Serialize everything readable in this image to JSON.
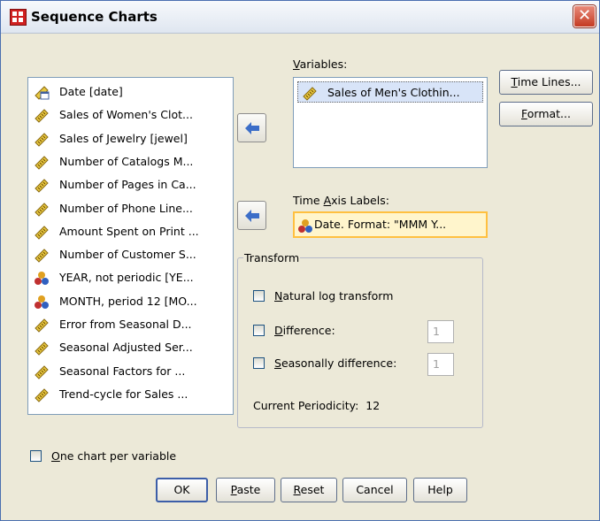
{
  "window": {
    "title": "Sequence Charts",
    "close_glyph": "✕"
  },
  "source_list": {
    "items": [
      {
        "label": "Date [date]",
        "icon": "date-scale-icon"
      },
      {
        "label": "Sales of Women's Clot...",
        "icon": "scale-variable-icon"
      },
      {
        "label": "Sales of Jewelry [jewel]",
        "icon": "scale-variable-icon"
      },
      {
        "label": "Number of Catalogs M...",
        "icon": "scale-variable-icon"
      },
      {
        "label": "Number of Pages in Ca...",
        "icon": "scale-variable-icon"
      },
      {
        "label": "Number of Phone Line...",
        "icon": "scale-variable-icon"
      },
      {
        "label": "Amount Spent on Print ...",
        "icon": "scale-variable-icon"
      },
      {
        "label": "Number of Customer S...",
        "icon": "scale-variable-icon"
      },
      {
        "label": "YEAR, not periodic [YE...",
        "icon": "nominal-variable-icon"
      },
      {
        "label": "MONTH, period 12 [MO...",
        "icon": "nominal-variable-icon"
      },
      {
        "label": "Error from Seasonal D...",
        "icon": "scale-variable-icon"
      },
      {
        "label": "Seasonal Adjusted Ser...",
        "icon": "scale-variable-icon"
      },
      {
        "label": "Seasonal Factors for ...",
        "icon": "scale-variable-icon"
      },
      {
        "label": "Trend-cycle for Sales ...",
        "icon": "scale-variable-icon"
      }
    ]
  },
  "variables": {
    "label_pre": "",
    "label_key": "V",
    "label_post": "ariables:",
    "item": "Sales of Men's Clothin..."
  },
  "time_axis": {
    "label_pre": "Time ",
    "label_key": "A",
    "label_post": "xis Labels:",
    "item": "Date. Format: \"MMM Y..."
  },
  "transform": {
    "title": "Transform",
    "natural_log": {
      "key": "N",
      "rest": "atural log transform",
      "checked": false
    },
    "difference": {
      "key": "D",
      "rest": "ifference:",
      "checked": false,
      "value": "1"
    },
    "seasonal": {
      "key": "S",
      "rest": "easonally difference:",
      "checked": false,
      "value": "1"
    },
    "periodicity_label": "Current Periodicity:",
    "periodicity_value": "12"
  },
  "side_buttons": {
    "time_lines": {
      "key": "T",
      "rest": "ime Lines..."
    },
    "format": {
      "key": "F",
      "rest": "ormat..."
    }
  },
  "one_chart": {
    "key": "O",
    "rest": "ne chart per variable",
    "checked": false
  },
  "buttons": {
    "ok": "OK",
    "paste": {
      "key": "P",
      "rest": "aste"
    },
    "reset": {
      "key": "R",
      "rest": "eset"
    },
    "cancel": "Cancel",
    "help": "Help"
  },
  "colors": {
    "accent_blue": "#3c6ec8",
    "highlight": "#fff5cc",
    "title_bg": "#dfe6f0"
  }
}
